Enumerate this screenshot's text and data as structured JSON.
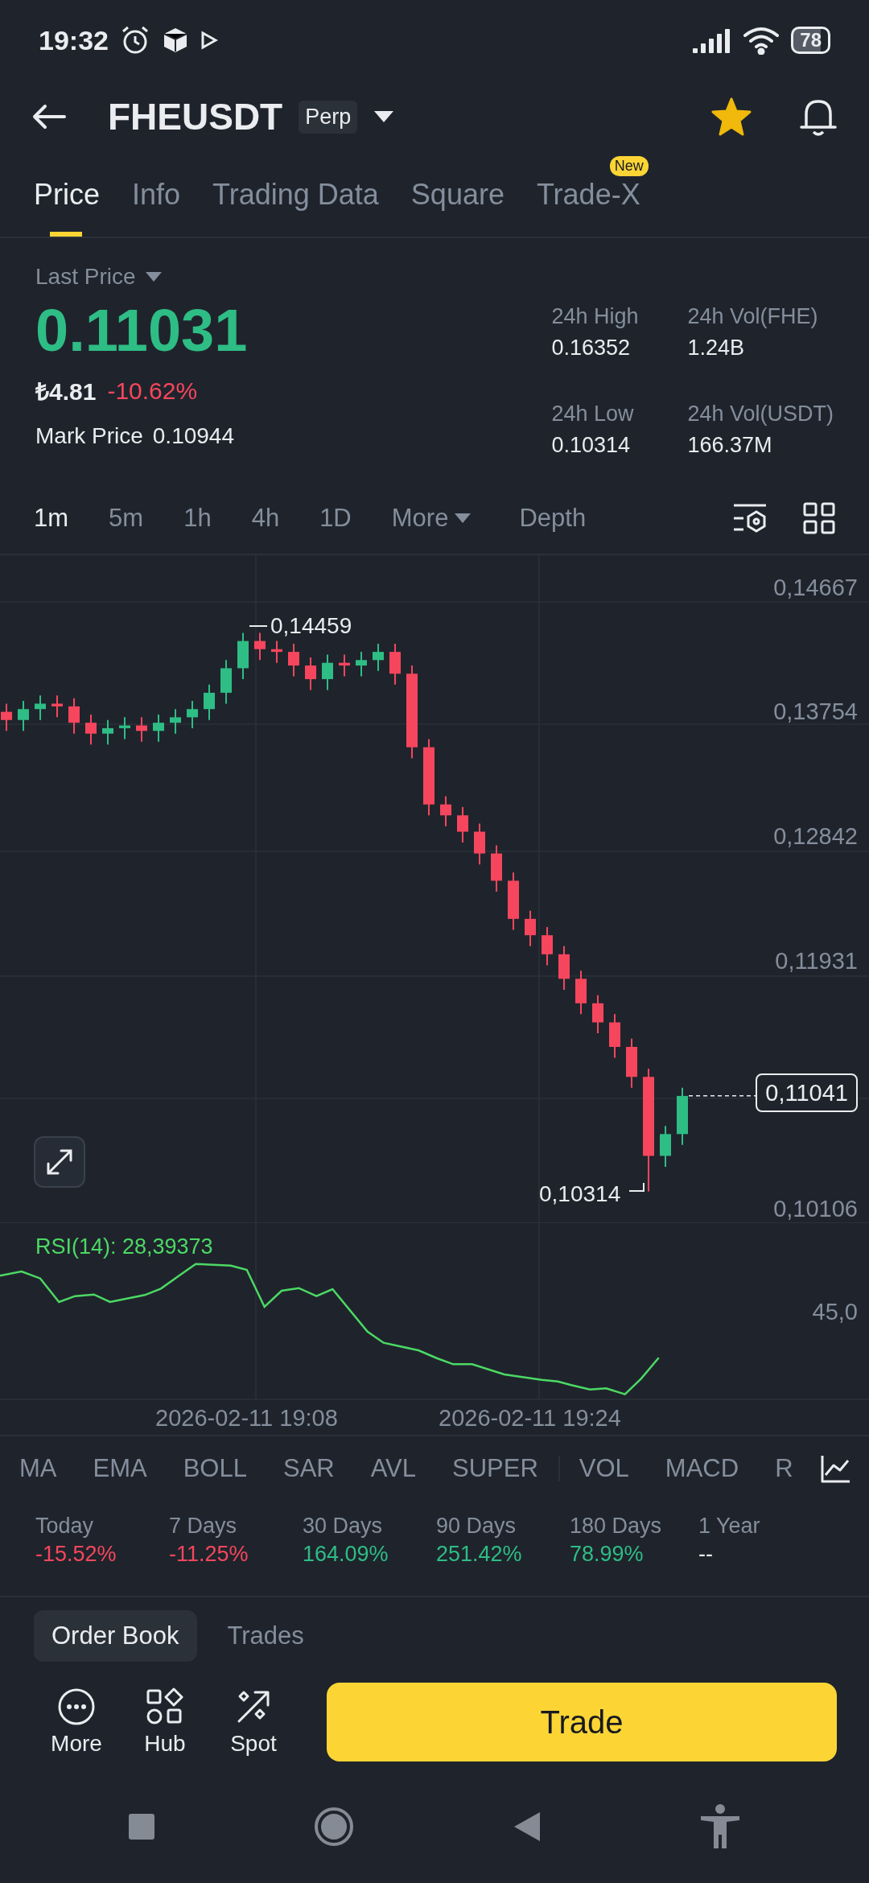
{
  "status_bar": {
    "time": "19:32",
    "battery": "78"
  },
  "header": {
    "symbol": "FHEUSDT",
    "badge": "Perp",
    "favorite": true
  },
  "tabs": [
    {
      "label": "Price",
      "selected": true
    },
    {
      "label": "Info",
      "selected": false
    },
    {
      "label": "Trading Data",
      "selected": false
    },
    {
      "label": "Square",
      "selected": false
    },
    {
      "label": "Trade-X",
      "selected": false,
      "badge": "New"
    }
  ],
  "price": {
    "label": "Last Price",
    "last": "0.11031",
    "local": "₺4.81",
    "change": "-10.62%",
    "mark_label": "Mark Price",
    "mark": "0.10944"
  },
  "stats": [
    {
      "label": "24h High",
      "value": "0.16352"
    },
    {
      "label": "24h Vol(FHE)",
      "value": "1.24B"
    },
    {
      "label": "24h Low",
      "value": "0.10314"
    },
    {
      "label": "24h Vol(USDT)",
      "value": "166.37M"
    }
  ],
  "intervals": [
    {
      "label": "1m",
      "kind": "interval",
      "selected": true
    },
    {
      "label": "5m",
      "kind": "interval",
      "selected": false
    },
    {
      "label": "1h",
      "kind": "interval",
      "selected": false
    },
    {
      "label": "4h",
      "kind": "interval",
      "selected": false
    },
    {
      "label": "1D",
      "kind": "interval",
      "selected": false
    },
    {
      "label": "More",
      "kind": "dropdown",
      "selected": false
    },
    {
      "label": "Depth",
      "kind": "view",
      "selected": false
    }
  ],
  "chart": {
    "price_labels": [
      "0,14667",
      "0,13754",
      "0,12842",
      "0,11931",
      "0,10106"
    ],
    "current_price": "0,11041",
    "high_marker": "0,14459",
    "low_marker": "0,10314",
    "rsi_label": "RSI(14): 28,39373",
    "rsi_tick": "45,0",
    "time_labels": [
      "2026-02-11 19:08",
      "2026-02-11 19:24"
    ]
  },
  "main_indicators": [
    "MA",
    "EMA",
    "BOLL",
    "SAR",
    "AVL",
    "SUPER"
  ],
  "sub_indicators": [
    "VOL",
    "MACD",
    "R"
  ],
  "performance": [
    {
      "label": "Today",
      "value": "-15.52%",
      "color": "#f6465d"
    },
    {
      "label": "7 Days",
      "value": "-11.25%",
      "color": "#f6465d"
    },
    {
      "label": "30 Days",
      "value": "164.09%",
      "color": "#2ebd85"
    },
    {
      "label": "90 Days",
      "value": "251.42%",
      "color": "#2ebd85"
    },
    {
      "label": "180 Days",
      "value": "78.99%",
      "color": "#2ebd85"
    },
    {
      "label": "1 Year",
      "value": "--",
      "color": "#eaecef"
    }
  ],
  "book_tabs": [
    {
      "label": "Order Book",
      "selected": true
    },
    {
      "label": "Trades",
      "selected": false
    }
  ],
  "bottom_actions": [
    {
      "label": "More"
    },
    {
      "label": "Hub"
    },
    {
      "label": "Spot"
    }
  ],
  "trade_button": "Trade"
}
